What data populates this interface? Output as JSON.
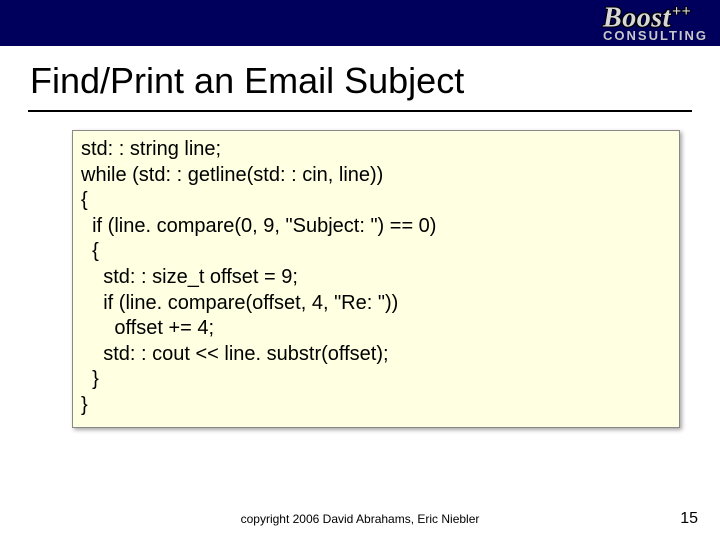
{
  "logo": {
    "brand": "Boost",
    "plus": "++",
    "sub": "CONSULTING"
  },
  "title": "Find/Print an Email Subject",
  "code": {
    "l0": "std: : string line;",
    "l1": "while (std: : getline(std: : cin, line))",
    "l2": "{",
    "l3": "  if (line. compare(0, 9, \"Subject: \") == 0)",
    "l4": "  {",
    "l5": "    std: : size_t offset = 9;",
    "l6": "    if (line. compare(offset, 4, \"Re: \"))",
    "l7": "      offset += 4;",
    "l8": "    std: : cout << line. substr(offset);",
    "l9": "  }",
    "l10": "}"
  },
  "footer": {
    "copyright": "copyright 2006 David Abrahams, Eric Niebler",
    "page": "15"
  }
}
